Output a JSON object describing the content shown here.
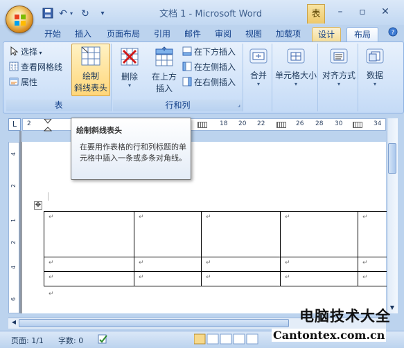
{
  "window": {
    "title": "文档 1 - Microsoft Word",
    "context_tab_title": "表"
  },
  "tabs": [
    {
      "label": "开始"
    },
    {
      "label": "插入"
    },
    {
      "label": "页面布局"
    },
    {
      "label": "引用"
    },
    {
      "label": "邮件"
    },
    {
      "label": "审阅"
    },
    {
      "label": "视图"
    },
    {
      "label": "加载项"
    },
    {
      "label": "设计"
    },
    {
      "label": "布局"
    }
  ],
  "active_tab": "布局",
  "ribbon": {
    "table_group": {
      "label": "表",
      "select": "选择",
      "view_gridlines": "查看网格线",
      "properties": "属性",
      "draw_diagonal_line1": "绘制",
      "draw_diagonal_line2": "斜线表头"
    },
    "rows_cols_group": {
      "label": "行和列",
      "delete": "删除",
      "insert_above1": "在上方",
      "insert_above2": "插入",
      "insert_below": "在下方插入",
      "insert_left": "在左侧插入",
      "insert_right": "在右侧插入"
    },
    "merge": "合并",
    "cell_size": "单元格大小",
    "alignment": "对齐方式",
    "data": "数据"
  },
  "ruler": {
    "corner_glyph": "L",
    "h_numbers": [
      "2",
      "18",
      "20",
      "22",
      "24",
      "26",
      "28",
      "30",
      "34"
    ],
    "v_numbers": [
      "4",
      "2",
      "1",
      "2",
      "4",
      "6"
    ]
  },
  "tooltip": {
    "title": "绘制斜线表头",
    "body": "在要用作表格的行和列标题的单元格中插入一条或多条对角线。"
  },
  "document": {
    "cell_mark": "↵"
  },
  "status": {
    "page": "页面: 1/1",
    "words": "字数: 0"
  },
  "watermark": {
    "cn": "电脑技术大全",
    "en": "Cantontex.com.cn"
  },
  "colors": {
    "ribbon_bg": "#d3e4f9",
    "ribbon_border": "#8db2e3",
    "context_tab": "#f4dc97",
    "tab_text": "#15428b"
  }
}
